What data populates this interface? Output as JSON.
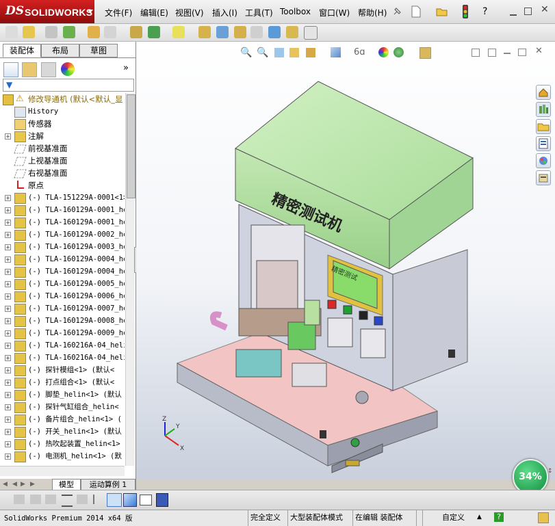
{
  "app": {
    "logo_ds": "DS",
    "logo_name": "SOLIDWORKS"
  },
  "menu": [
    "文件(F)",
    "编辑(E)",
    "视图(V)",
    "插入(I)",
    "工具(T)",
    "Toolbox",
    "窗口(W)",
    "帮助(H)"
  ],
  "panel_tabs": [
    "装配体",
    "布局",
    "草图"
  ],
  "tree": {
    "root": "修改导通机  (默认<默认_显",
    "items": [
      {
        "label": "History",
        "icon": "history-icon",
        "expand": false
      },
      {
        "label": "传感器",
        "icon": "sensor-icon",
        "expand": false
      },
      {
        "label": "注解",
        "icon": "annotation-icon",
        "expand": true
      },
      {
        "label": "前视基准面",
        "icon": "plane-icon",
        "expand": false
      },
      {
        "label": "上视基准面",
        "icon": "plane-icon",
        "expand": false
      },
      {
        "label": "右视基准面",
        "icon": "plane-icon",
        "expand": false
      },
      {
        "label": "原点",
        "icon": "origin-icon",
        "expand": false
      },
      {
        "label": "(-) TLA-151229A-0001<1>",
        "icon": "part-icon",
        "expand": true
      },
      {
        "label": "(-) TLA-160129A-0001_he",
        "icon": "part-icon",
        "expand": true
      },
      {
        "label": "(-) TLA-160129A-0001_he",
        "icon": "part-icon",
        "expand": true
      },
      {
        "label": "(-) TLA-160129A-0002_he",
        "icon": "part-icon",
        "expand": true
      },
      {
        "label": "(-) TLA-160129A-0003_he",
        "icon": "part-icon",
        "expand": true
      },
      {
        "label": "(-) TLA-160129A-0004_he",
        "icon": "part-icon",
        "expand": true
      },
      {
        "label": "(-) TLA-160129A-0004_he",
        "icon": "part-icon",
        "expand": true
      },
      {
        "label": "(-) TLA-160129A-0005_he",
        "icon": "part-icon",
        "expand": true
      },
      {
        "label": "(-) TLA-160129A-0006_he",
        "icon": "part-icon",
        "expand": true
      },
      {
        "label": "(-) TLA-160129A-0007_he",
        "icon": "part-icon",
        "expand": true
      },
      {
        "label": "(-) TLA-160129A-0008_he",
        "icon": "part-icon",
        "expand": true
      },
      {
        "label": "(-) TLA-160129A-0009_he",
        "icon": "part-icon",
        "expand": true
      },
      {
        "label": "(-) TLA-160216A-04_heli",
        "icon": "part-icon",
        "expand": true
      },
      {
        "label": "(-) TLA-160216A-04_heli",
        "icon": "part-icon",
        "expand": true
      },
      {
        "label": "(-) 探针模组<1> (默认<",
        "icon": "part-icon",
        "expand": true
      },
      {
        "label": "(-) 打点组合<1> (默认<",
        "icon": "part-icon",
        "expand": true
      },
      {
        "label": "(-) 脚垫_helin<1> (默认",
        "icon": "part-icon",
        "expand": true
      },
      {
        "label": "(-) 探针气缸组合_helin<",
        "icon": "part-icon",
        "expand": true
      },
      {
        "label": "(-) 备片组合_helin<1> (",
        "icon": "part-icon",
        "expand": true
      },
      {
        "label": "(-) 开关_helin<1> (默认",
        "icon": "part-icon",
        "expand": true
      },
      {
        "label": "(-) 热吹起装置_helin<1>",
        "icon": "part-icon",
        "expand": true
      },
      {
        "label": "(-) 电测机_helin<1> (默",
        "icon": "part-icon",
        "expand": true
      }
    ]
  },
  "bottom_tabs": [
    "模型",
    "运动算例 1"
  ],
  "machine": {
    "label": "精密测试机",
    "screen_label": "精密测试"
  },
  "zoom": "34%",
  "status": {
    "app": "SolidWorks Premium 2014 x64 版",
    "cells": [
      "完全定义",
      "大型装配体模式",
      "在编辑 装配体",
      "自定义"
    ]
  },
  "colors": {
    "accent": "#c81818",
    "cover": "#bfe6b0",
    "base": "#f2c4c4",
    "frame": "#c9cbd8"
  }
}
